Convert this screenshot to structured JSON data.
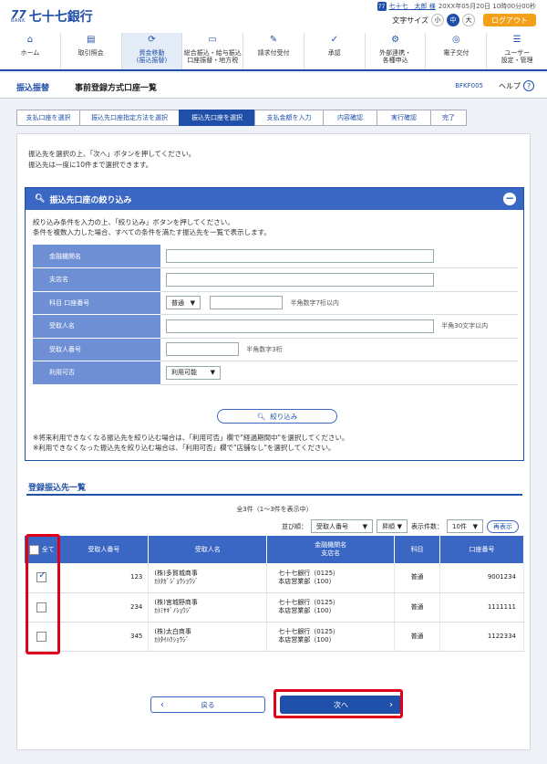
{
  "header": {
    "logo_mark": "77",
    "logo_sub": "BANK",
    "bank_name": "七十七銀行",
    "user_name": "七十七　太郎 様",
    "login_time": "20XX年05月20日 10時00分00秒",
    "text_size_label": "文字サイズ",
    "size_small": "小",
    "size_medium": "中",
    "size_large": "大",
    "logout_label": "ログアウト"
  },
  "nav": [
    {
      "icon": "⌂",
      "icon_name": "home-icon",
      "label": "ホーム"
    },
    {
      "icon": "▤",
      "icon_name": "inquiry-icon",
      "label": "取引照会"
    },
    {
      "icon": "⟳",
      "icon_name": "transfer-icon",
      "label": "資金移動\n(振込振替)"
    },
    {
      "icon": "▭",
      "icon_name": "payroll-icon",
      "label": "総合振込・給与振込\n口座振替・地方税"
    },
    {
      "icon": "✎",
      "icon_name": "request-icon",
      "label": "請求付受付"
    },
    {
      "icon": "✓",
      "icon_name": "approval-icon",
      "label": "承認"
    },
    {
      "icon": "⚙",
      "icon_name": "external-icon",
      "label": "外部連携・\n各種申込"
    },
    {
      "icon": "◎",
      "icon_name": "etrade-icon",
      "label": "電子交付"
    },
    {
      "icon": "☰",
      "icon_name": "user-settings-icon",
      "label": "ユーザー\n設定・管理"
    }
  ],
  "title_bar": {
    "crumb": "振込振替",
    "page_title": "事前登録方式口座一覧",
    "screen_id": "BFKF005",
    "help_label": "ヘルプ"
  },
  "steps": [
    {
      "label": "支払口座を選択"
    },
    {
      "label": "振込先口座指定方法を選択"
    },
    {
      "label": "振込先口座を選択"
    },
    {
      "label": "支払金額を入力"
    },
    {
      "label": "内容確認"
    },
    {
      "label": "実行確認"
    },
    {
      "label": "完了"
    }
  ],
  "intro": {
    "line1": "振込先を選択の上、「次へ」ボタンを押してください。",
    "line2": "振込先は一度に10件まで選択できます。"
  },
  "filter": {
    "title": "振込先口座の絞り込み",
    "desc1": "絞り込み条件を入力の上、「絞り込み」ボタンを押してください。",
    "desc2": "条件を複数入力した場合、すべての条件を満たす振込先を一覧で表示します。",
    "labels": {
      "bank": "金融機関名",
      "branch": "支店名",
      "account": "科目 口座番号",
      "payee": "受取人名",
      "payee_no": "受取人番号",
      "availability": "利用可否"
    },
    "account_type": "普通",
    "account_hint": "半角数字7桁以内",
    "payee_hint": "半角30文字以内",
    "payee_no_hint": "半角数字3桁",
    "availability_value": "利用可能",
    "button_label": "絞り込み",
    "note1": "※将来利用できなくなる振込先を絞り込む場合は、「利用可否」欄で\"経過期間中\"を選択してください。",
    "note2": "※利用できなくなった振込先を絞り込む場合は、「利用可否」欄で\"店舗なし\"を選択してください。"
  },
  "list": {
    "title": "登録振込先一覧",
    "count_text": "全3件（1～3件を表示中）",
    "sort_label": "並び順：",
    "sort_key": "受取人番号",
    "sort_order": "昇順",
    "display_count_label": "表示件数：",
    "display_count": "10件",
    "redisplay_label": "再表示",
    "headers": {
      "all": "全て",
      "payee_no": "受取人番号",
      "payee_name": "受取人名",
      "bank_branch_1": "金融機関名",
      "bank_branch_2": "支店名",
      "subject": "科目",
      "account_no": "口座番号"
    },
    "rows": [
      {
        "checked": true,
        "payee_no": "123",
        "name": "(株)多賀城商事",
        "kana": "ｶ)ﾀｶﾞｼﾞｮｳｼｮｳｼﾞ",
        "bank": "七十七銀行（0125）",
        "branch": "本店営業部（100）",
        "subject": "普通",
        "account": "9001234"
      },
      {
        "checked": false,
        "payee_no": "234",
        "name": "(株)宮城野商事",
        "kana": "ｶ)ﾐﾔｷﾞﾉｼｮｳｼﾞ",
        "bank": "七十七銀行（0125）",
        "branch": "本店営業部（100）",
        "subject": "普通",
        "account": "1111111"
      },
      {
        "checked": false,
        "payee_no": "345",
        "name": "(株)太白商事",
        "kana": "ｶ)ﾀｲﾊｸｼｮｳｼﾞ",
        "bank": "七十七銀行（0125）",
        "branch": "本店営業部（100）",
        "subject": "普通",
        "account": "1122334"
      }
    ]
  },
  "buttons": {
    "back_label": "戻る",
    "next_label": "次へ"
  }
}
